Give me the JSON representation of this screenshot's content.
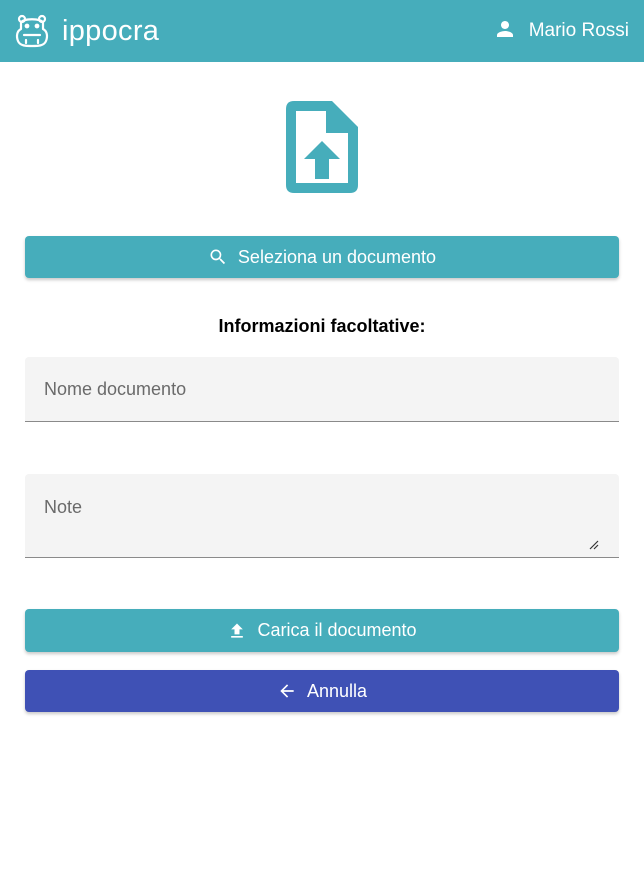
{
  "header": {
    "brand_name": "ippocra",
    "user_name": "Mario Rossi"
  },
  "icons": {
    "brand": "hippo-logo-icon",
    "user": "person-icon",
    "hero": "file-upload-icon",
    "search": "search-icon",
    "upload": "upload-icon",
    "back": "arrow-back-icon"
  },
  "actions": {
    "select_label": "Seleziona un documento",
    "upload_label": "Carica il documento",
    "cancel_label": "Annulla"
  },
  "form": {
    "section_title": "Informazioni facoltative:",
    "name_placeholder": "Nome documento",
    "name_value": "",
    "note_placeholder": "Note",
    "note_value": ""
  },
  "colors": {
    "primary": "#46adbb",
    "secondary": "#3f51b5",
    "field_bg": "#f4f4f4"
  }
}
